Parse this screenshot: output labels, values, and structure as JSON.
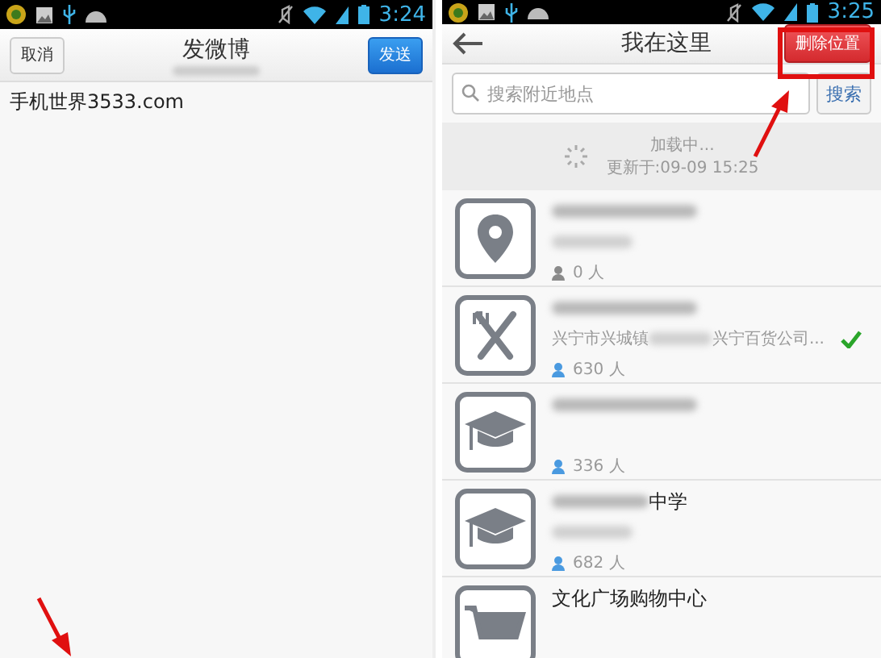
{
  "compose_screen": {
    "status_bar": {
      "time": "3:24"
    },
    "header": {
      "cancel_button": "取消",
      "title": "发微博",
      "send_button": "发送"
    },
    "body": {
      "text": "手机世界3533.com"
    }
  },
  "places_screen": {
    "status_bar": {
      "time": "3:25"
    },
    "header": {
      "title": "我在这里",
      "delete_location_button": "删除位置"
    },
    "search": {
      "placeholder": "搜索附近地点",
      "button": "搜索"
    },
    "loading": {
      "text": "加载中...",
      "updated": "更新于:09-09 15:25"
    },
    "places": [
      {
        "kind": "area",
        "title_blurred": true,
        "address_blurred": true,
        "count": "0 人",
        "selected": false
      },
      {
        "kind": "restaurant",
        "title_blurred": true,
        "address_blurred": false,
        "address_start": "兴宁市兴城镇",
        "address_end": "兴宁百货公司...",
        "count": "630 人",
        "selected": true
      },
      {
        "kind": "school",
        "title_blurred": true,
        "address_blurred": false,
        "count": "336 人",
        "selected": false
      },
      {
        "kind": "school",
        "title_blurred": true,
        "title_end": "中学",
        "address_blurred": true,
        "count": "682 人",
        "selected": false
      },
      {
        "kind": "shopping",
        "title_blurred": false,
        "title": "文化广场购物中心",
        "address_blurred": false,
        "selected": false
      }
    ]
  }
}
